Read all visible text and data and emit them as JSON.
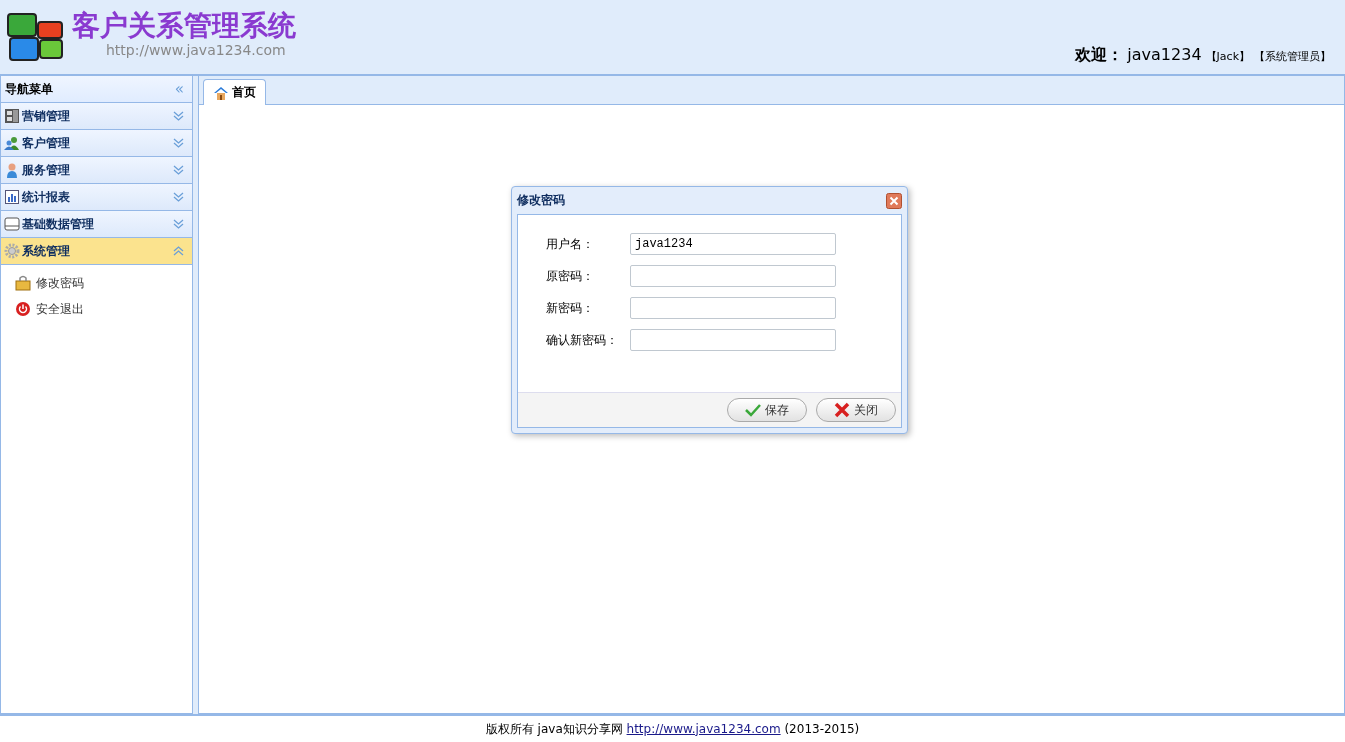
{
  "header": {
    "title": "客户关系管理系统",
    "url": "http://www.java1234.com",
    "welcome_label": "欢迎：",
    "username": "java1234",
    "name": "【Jack】",
    "role": "【系统管理员】"
  },
  "sidebar": {
    "title": "导航菜单",
    "collapse_icon": "«",
    "items": [
      {
        "label": "营销管理",
        "expanded": false
      },
      {
        "label": "客户管理",
        "expanded": false
      },
      {
        "label": "服务管理",
        "expanded": false
      },
      {
        "label": "统计报表",
        "expanded": false
      },
      {
        "label": "基础数据管理",
        "expanded": false
      },
      {
        "label": "系统管理",
        "expanded": true,
        "children": [
          {
            "label": "修改密码"
          },
          {
            "label": "安全退出"
          }
        ]
      }
    ]
  },
  "tabs": [
    {
      "label": "首页",
      "selected": true
    }
  ],
  "dialog": {
    "title": "修改密码",
    "fields": [
      {
        "label": "用户名：",
        "value": "java1234"
      },
      {
        "label": "原密码："
      },
      {
        "label": "新密码："
      },
      {
        "label": "确认新密码："
      }
    ],
    "buttons": [
      "保存",
      "关闭"
    ]
  },
  "footer": {
    "text_before": "版权所有 java知识分享网 ",
    "link": "http://www.java1234.com",
    "text_after": " (2013-2015)"
  }
}
